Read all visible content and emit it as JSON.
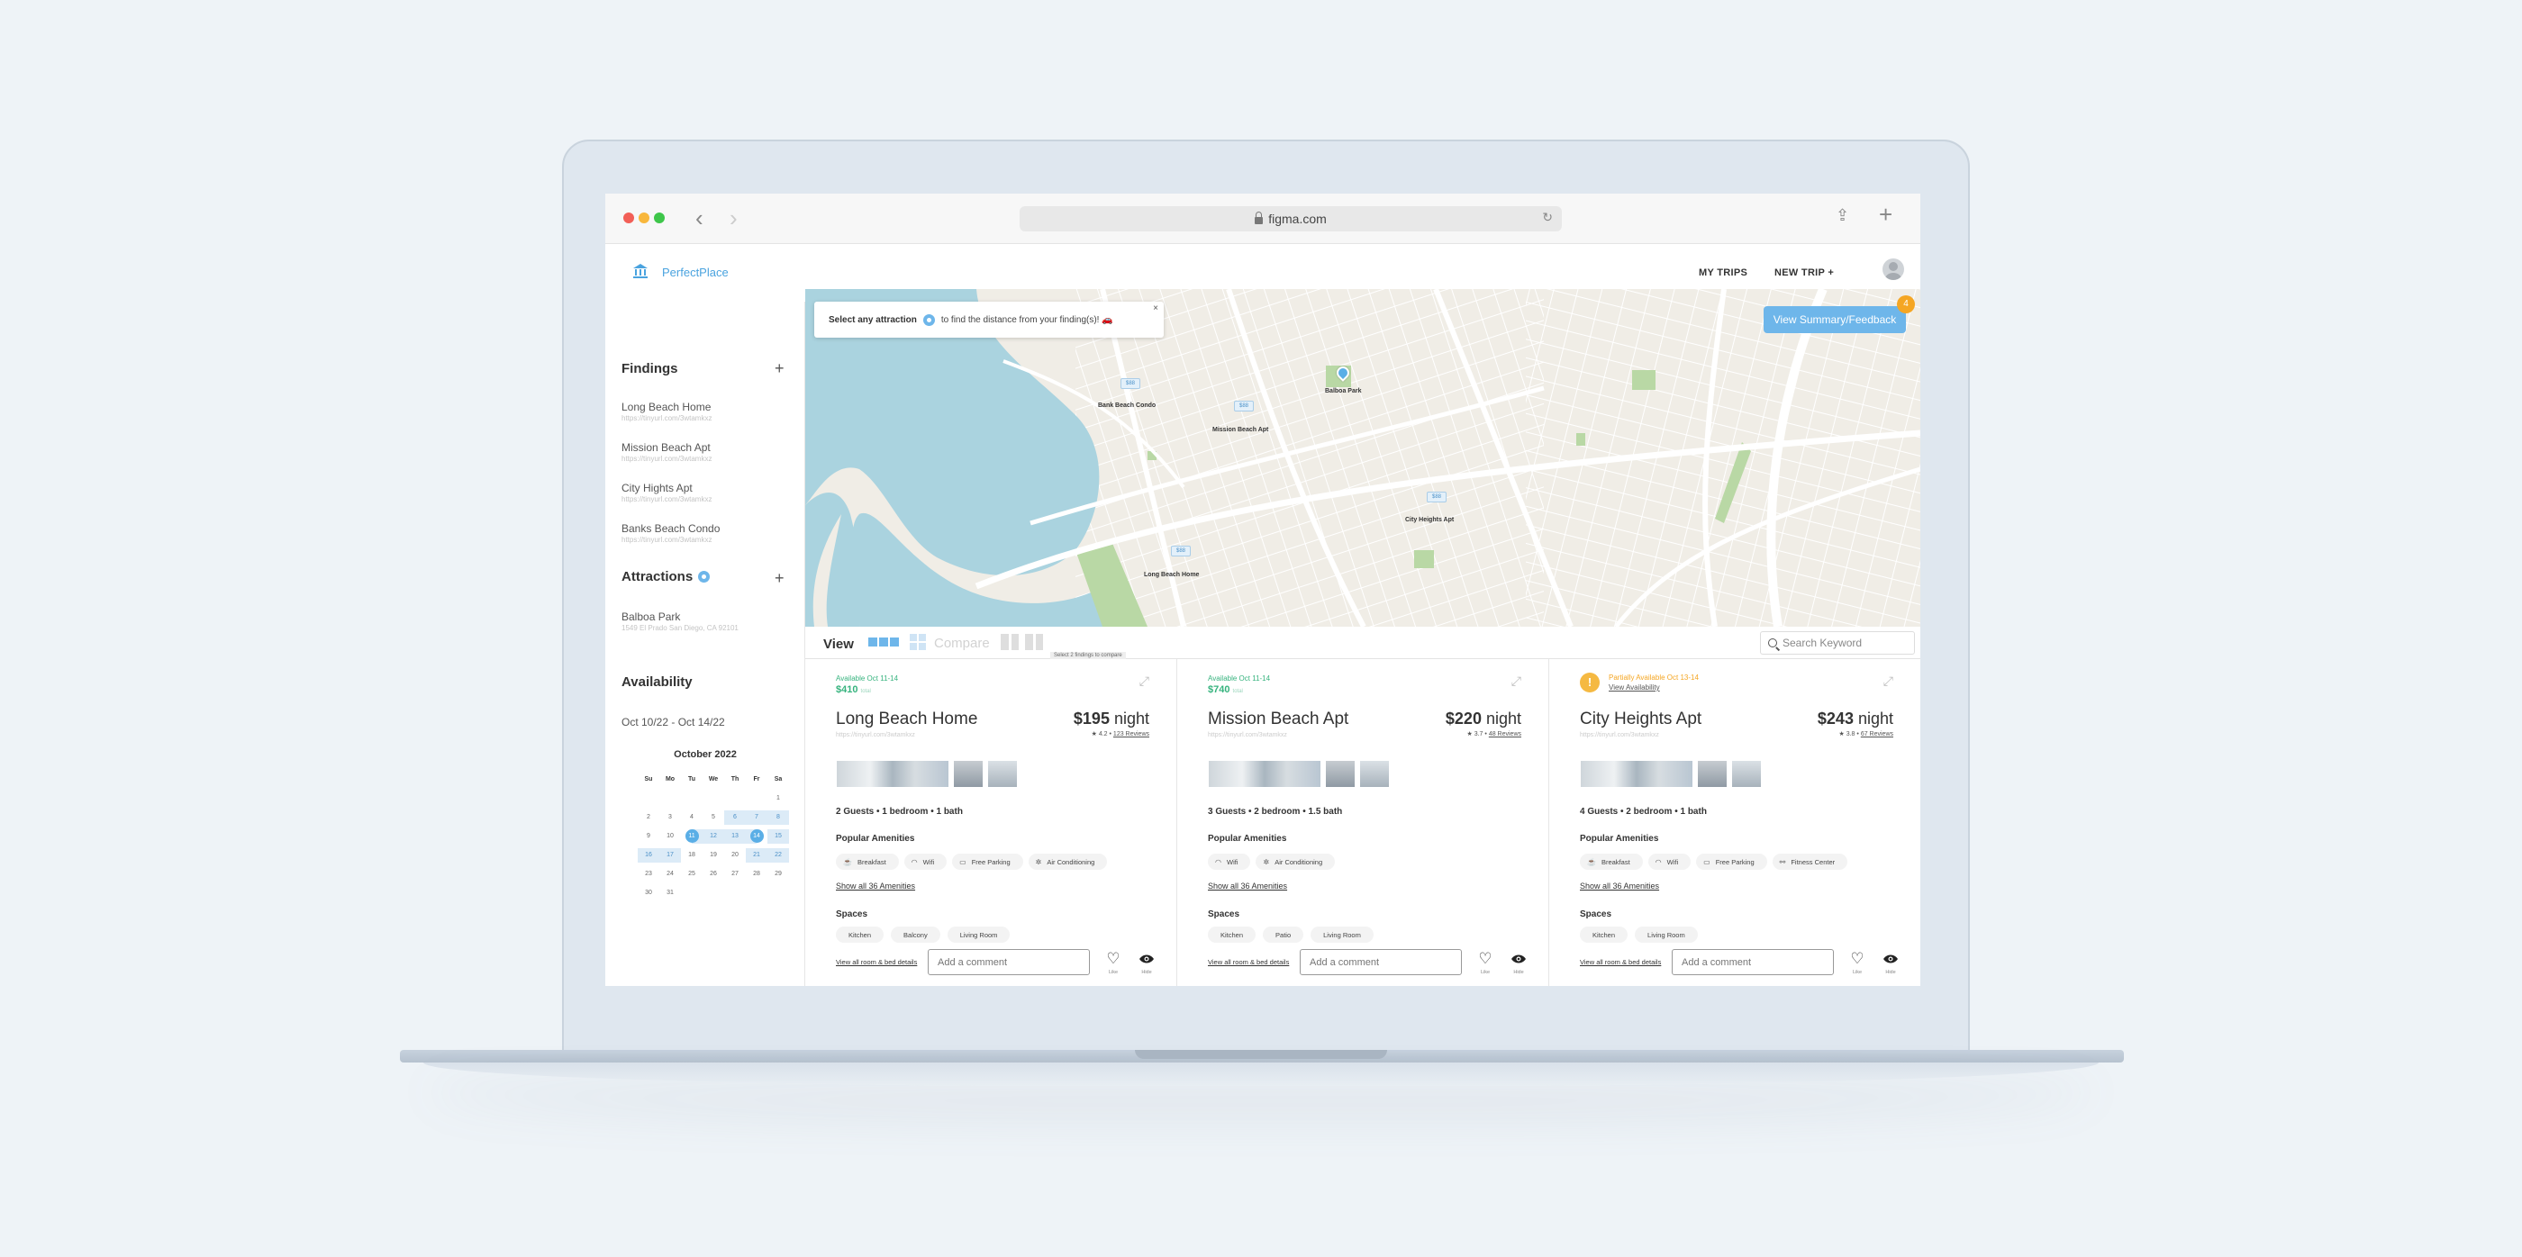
{
  "browser": {
    "url": "figma.com"
  },
  "header": {
    "brand": "PerfectPlace",
    "my_trips": "MY TRIPS",
    "new_trip": "NEW TRIP  +"
  },
  "sidebar": {
    "findings_title": "Findings",
    "findings": [
      {
        "title": "Long Beach Home",
        "url": "https://tinyurl.com/3wtamkxz"
      },
      {
        "title": "Mission Beach Apt",
        "url": "https://tinyurl.com/3wtamkxz"
      },
      {
        "title": "City Hights Apt",
        "url": "https://tinyurl.com/3wtamkxz"
      },
      {
        "title": "Banks Beach Condo",
        "url": "https://tinyurl.com/3wtamkxz"
      }
    ],
    "attractions_title": "Attractions",
    "attractions": [
      {
        "title": "Balboa Park",
        "address": "1549 El Prado San Diego, CA 92101"
      }
    ],
    "availability_title": "Availability",
    "availability_range": "Oct 10/22 - Oct 14/22",
    "calendar": {
      "month": "October 2022",
      "days": [
        "Su",
        "Mo",
        "Tu",
        "We",
        "Th",
        "Fr",
        "Sa"
      ],
      "weeks": [
        [
          "",
          "",
          "",
          "",
          "",
          "",
          "1"
        ],
        [
          "2",
          "3",
          "4",
          "5",
          "6",
          "7",
          "8"
        ],
        [
          "9",
          "10",
          "11",
          "12",
          "13",
          "14",
          "15"
        ],
        [
          "16",
          "17",
          "18",
          "19",
          "20",
          "21",
          "22"
        ],
        [
          "23",
          "24",
          "25",
          "26",
          "27",
          "28",
          "29"
        ],
        [
          "30",
          "31",
          "",
          "",
          "",
          "",
          ""
        ]
      ],
      "range_start": "11",
      "range_end": "14",
      "range_days": [
        "6",
        "7",
        "8",
        "11",
        "12",
        "13",
        "14",
        "15",
        "16",
        "17",
        "21",
        "22"
      ]
    }
  },
  "map": {
    "tooltip_pre": "Select any attraction",
    "tooltip_post": "to find the distance from your finding(s)! 🚗",
    "tooltip_close": "×",
    "feedback_button": "View Summary/Feedback",
    "feedback_badge": "4",
    "pins": [
      {
        "label": "Bank Beach Condo",
        "price": "$88"
      },
      {
        "label": "Mission Beach Apt",
        "price": "$88"
      },
      {
        "label": "City Heights Apt",
        "price": "$88"
      },
      {
        "label": "Long Beach Home",
        "price": "$88"
      }
    ],
    "attraction_label": "Balboa Park"
  },
  "viewbar": {
    "view": "View",
    "compare": "Compare",
    "compare_tip": "Select 2 findings to compare",
    "search_placeholder": "Search Keyword"
  },
  "cards": [
    {
      "availability": "Available Oct 11-14",
      "total": "$410",
      "total_suffix": "total",
      "title": "Long Beach Home",
      "url": "https://tinyurl.com/3wtamkxz",
      "price": "$195",
      "price_unit": " night",
      "rating": "★  4.2  •",
      "reviews": "123 Reviews",
      "specs": "2 Guests  • 1 bedroom  • 1 bath",
      "amenities_title": "Popular Amenities",
      "amenities": [
        {
          "icon": "breakfast-icon",
          "glyph": "☕",
          "label": "Breakfast"
        },
        {
          "icon": "wifi-icon",
          "glyph": "◠",
          "label": "Wifi"
        },
        {
          "icon": "parking-icon",
          "glyph": "▭",
          "label": "Free Parking"
        },
        {
          "icon": "ac-icon",
          "glyph": "✲",
          "label": "Air Conditioning"
        }
      ],
      "show_amenities": "Show all 36 Amenities",
      "spaces_title": "Spaces",
      "spaces": [
        "Kitchen",
        "Balcony",
        "Living Room"
      ],
      "view_rooms": "View all room & bed details",
      "comment_placeholder": "Add a comment",
      "like_label": "Like",
      "hide_label": "Hide"
    },
    {
      "availability": "Available Oct 11-14",
      "total": "$740",
      "total_suffix": "total",
      "title": "Mission Beach Apt",
      "url": "https://tinyurl.com/3wtamkxz",
      "price": "$220",
      "price_unit": " night",
      "rating": "★  3.7  •",
      "reviews": "48 Reviews",
      "specs": "3 Guests  • 2 bedroom  •  1.5 bath",
      "amenities_title": "Popular Amenities",
      "amenities": [
        {
          "icon": "wifi-icon",
          "glyph": "◠",
          "label": "Wifi"
        },
        {
          "icon": "ac-icon",
          "glyph": "✲",
          "label": "Air Conditioning"
        }
      ],
      "show_amenities": "Show all 36 Amenities",
      "spaces_title": "Spaces",
      "spaces": [
        "Kitchen",
        "Patio",
        "Living Room"
      ],
      "view_rooms": "View all room & bed details",
      "comment_placeholder": "Add a comment",
      "like_label": "Like",
      "hide_label": "Hide"
    },
    {
      "availability": "Partially Available Oct 13-14",
      "availability_link": "View Availability",
      "title": "City Heights Apt",
      "url": "https://tinyurl.com/3wtamkxz",
      "price": "$243",
      "price_unit": " night",
      "rating": "★  3.8  •",
      "reviews": "67 Reviews",
      "specs": "4 Guests  • 2 bedroom  • 1 bath",
      "amenities_title": "Popular Amenities",
      "amenities": [
        {
          "icon": "breakfast-icon",
          "glyph": "☕",
          "label": "Breakfast"
        },
        {
          "icon": "wifi-icon",
          "glyph": "◠",
          "label": "Wifi"
        },
        {
          "icon": "parking-icon",
          "glyph": "▭",
          "label": "Free Parking"
        },
        {
          "icon": "fitness-icon",
          "glyph": "⚯",
          "label": "Fitness Center"
        }
      ],
      "show_amenities": "Show all 36 Amenities",
      "spaces_title": "Spaces",
      "spaces": [
        "Kitchen",
        "Living Room"
      ],
      "view_rooms": "View all room & bed details",
      "comment_placeholder": "Add a comment",
      "like_label": "Like",
      "hide_label": "Hide"
    }
  ],
  "colors": {
    "accent": "#6eb6ea",
    "available": "#36b37e",
    "partial": "#f5a623",
    "water": "#aad3df",
    "land": "#f2efe9",
    "park": "#b9d8a5"
  }
}
